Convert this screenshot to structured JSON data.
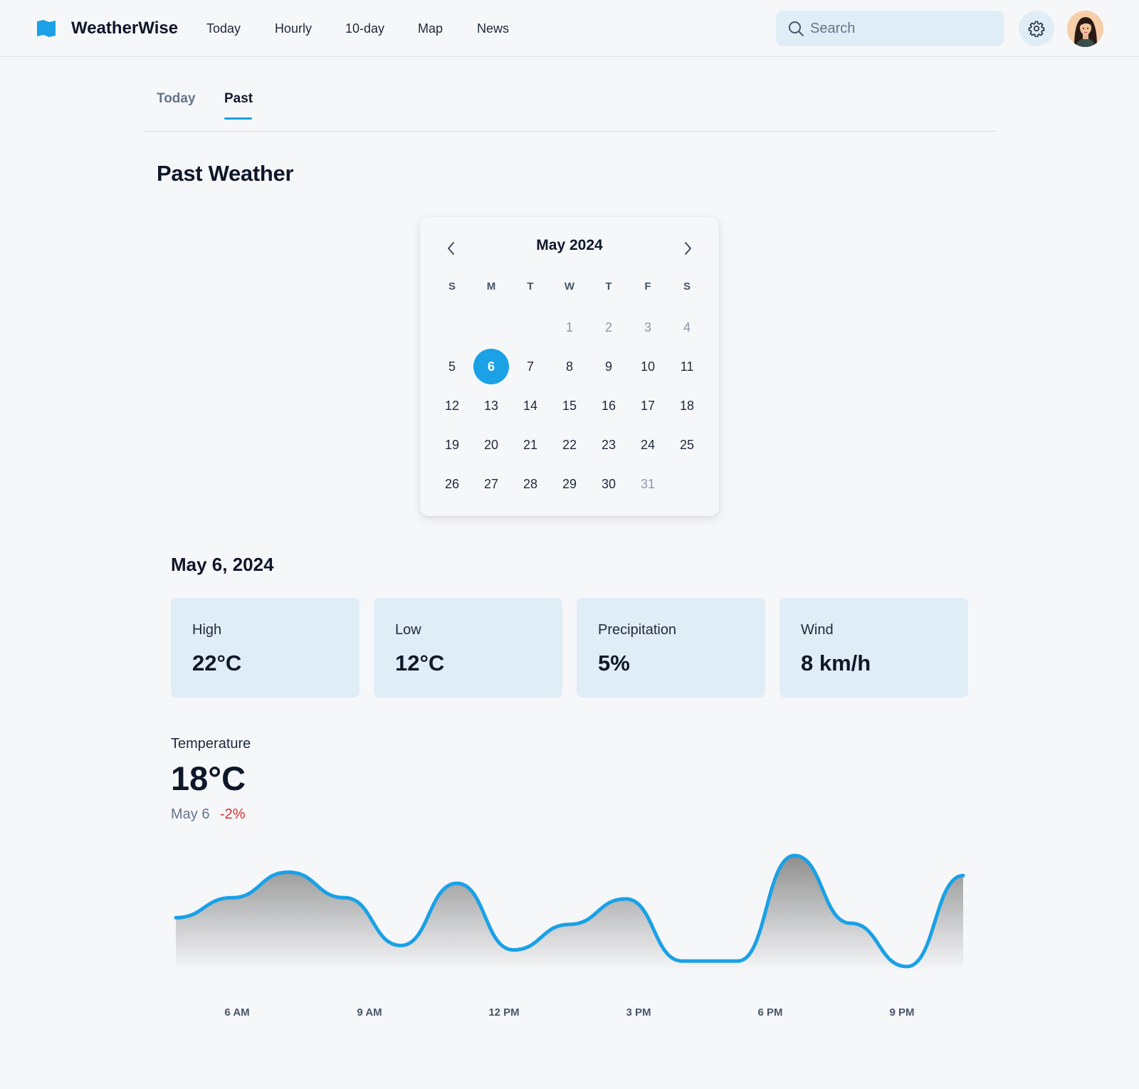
{
  "app": {
    "brand": "WeatherWise",
    "accent_color": "#1aa1e6",
    "nav": [
      "Today",
      "Hourly",
      "10-day",
      "Map",
      "News"
    ],
    "search_placeholder": "Search",
    "settings_icon": "gear-icon",
    "avatar_icon": "user-avatar"
  },
  "tabs": [
    "Today",
    "Past"
  ],
  "active_tab": "Past",
  "page_title": "Past Weather",
  "calendar": {
    "month_label": "May 2024",
    "weekdays": [
      "S",
      "M",
      "T",
      "W",
      "T",
      "F",
      "S"
    ],
    "selected_day": "6",
    "weeks": [
      [
        "",
        "",
        "",
        "1",
        "2",
        "3",
        "4"
      ],
      [
        "5",
        "6",
        "7",
        "8",
        "9",
        "10",
        "11"
      ],
      [
        "12",
        "13",
        "14",
        "15",
        "16",
        "17",
        "18"
      ],
      [
        "19",
        "20",
        "21",
        "22",
        "23",
        "24",
        "25"
      ],
      [
        "26",
        "27",
        "28",
        "29",
        "30",
        "31",
        ""
      ]
    ],
    "muted_days": [
      "1",
      "2",
      "3",
      "4",
      "31"
    ]
  },
  "day_summary": {
    "date": "May 6, 2024",
    "stats": [
      {
        "label": "High",
        "value": "22°C"
      },
      {
        "label": "Low",
        "value": "12°C"
      },
      {
        "label": "Precipitation",
        "value": "5%"
      },
      {
        "label": "Wind",
        "value": "8 km/h"
      }
    ]
  },
  "temperature": {
    "label": "Temperature",
    "value": "18°C",
    "date": "May 6",
    "change": "-2%",
    "change_color": "#e02d2d"
  },
  "chart_data": {
    "type": "area",
    "x_ticks": [
      "6 AM",
      "9 AM",
      "12 PM",
      "3 PM",
      "6 PM",
      "9 PM"
    ],
    "line_color": "#1aa1e6",
    "points": [
      0.44,
      0.62,
      0.85,
      0.62,
      0.19,
      0.75,
      0.15,
      0.38,
      0.61,
      0.05,
      0.05,
      1.0,
      0.39,
      0.0,
      0.82
    ]
  }
}
